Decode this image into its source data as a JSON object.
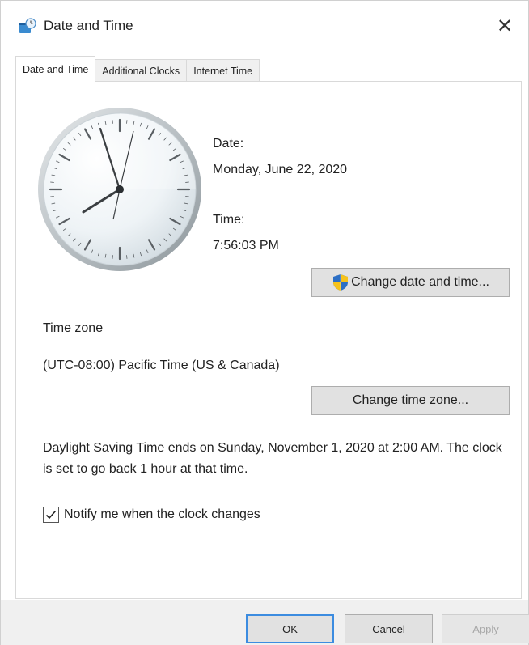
{
  "window": {
    "title": "Date and Time",
    "close_glyph": "✕"
  },
  "tabs": [
    {
      "label": "Date and Time",
      "active": true
    },
    {
      "label": "Additional Clocks",
      "active": false
    },
    {
      "label": "Internet Time",
      "active": false
    }
  ],
  "main": {
    "date_label": "Date:",
    "date_value": "Monday, June 22, 2020",
    "time_label": "Time:",
    "time_value": "7:56:03 PM",
    "change_datetime_button": "Change date and time...",
    "timezone_group_label": "Time zone",
    "timezone_value": "(UTC-08:00) Pacific Time (US & Canada)",
    "change_timezone_button": "Change time zone...",
    "dst_message": "Daylight Saving Time ends on Sunday, November 1, 2020 at 2:00 AM. The clock is set to go back 1 hour at that time.",
    "notify_checkbox_label": "Notify me when the clock changes",
    "notify_checked": true
  },
  "footer": {
    "ok": "OK",
    "cancel": "Cancel",
    "apply": "Apply"
  },
  "colors": {
    "accent_focus": "#3c8ce0",
    "button_face": "#e1e1e1",
    "button_border": "#adadad",
    "disabled_text": "#a8a8a8"
  },
  "icons": {
    "title": "date-time-icon",
    "uac": "shield-icon",
    "close": "close-icon",
    "check": "checkmark-icon"
  }
}
